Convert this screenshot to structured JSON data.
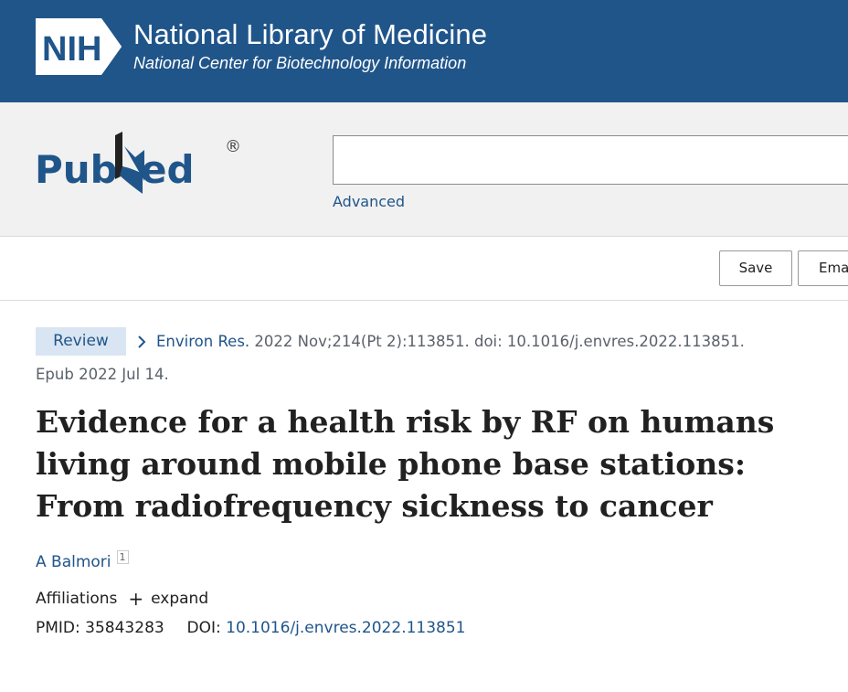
{
  "header": {
    "logo_text": "NIH",
    "title": "National Library of Medicine",
    "subtitle": "National Center for Biotechnology Information"
  },
  "search": {
    "logo_text": "PubMed",
    "logo_mark": "®",
    "query": "",
    "advanced_label": "Advanced"
  },
  "actions": {
    "save_label": "Save",
    "email_label": "Email"
  },
  "article": {
    "type_tag": "Review",
    "journal": "Environ Res.",
    "citation": " 2022 Nov;214(Pt 2):113851. doi: 10.1016/j.envres.2022.113851.",
    "epub": "Epub 2022 Jul 14.",
    "title": "Evidence for a health risk by RF on humans living around mobile phone base stations: From radiofrequency sickness to cancer",
    "author": "A Balmori",
    "author_affiliation_num": "1",
    "affiliations_label": "Affiliations",
    "expand_label": "expand",
    "pmid_label": "PMID:",
    "pmid": "35843283",
    "doi_label": "DOI:",
    "doi": "10.1016/j.envres.2022.113851"
  },
  "colors": {
    "nih_blue": "#20558a",
    "review_tag_bg": "#d9e5f2",
    "search_bg": "#f1f1f1"
  }
}
